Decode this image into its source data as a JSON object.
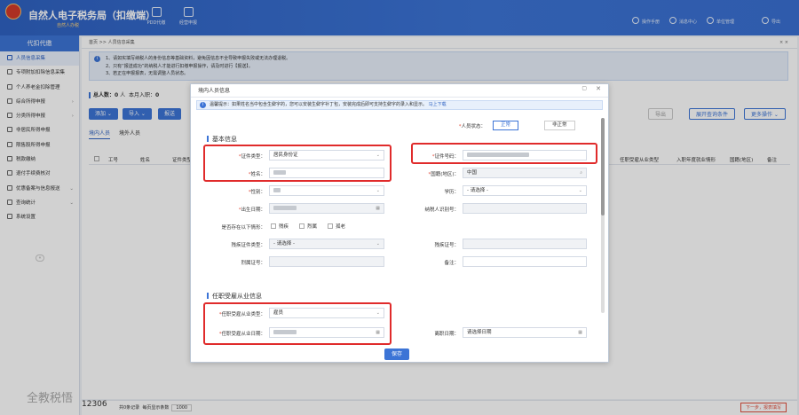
{
  "app": {
    "title": "自然人电子税务局（扣缴端）",
    "subtitle": "自然人办税",
    "toolbar": [
      "PDD代缴",
      "经营申报"
    ],
    "right_items": [
      "操作手册",
      "消息中心",
      "单位管理",
      "导出"
    ]
  },
  "sidebar": {
    "header": "代扣代缴",
    "items": [
      "人员信息采集",
      "专项附加扣除信息采集",
      "个人养老金扣除管理",
      "综合所得申报",
      "分类所得申报",
      "非居民所得申报",
      "限售股所得申报",
      "税款缴纳",
      "退付手续费核对",
      "优惠备案与信息报送",
      "查询统计",
      "系统设置"
    ]
  },
  "breadcrumb": {
    "home": "首页",
    "current": "人员信息采集"
  },
  "notice": [
    "1、请如实填写纳税人的身份信息等基础资料，避免因信息不全导致申报失败或无法办理退税。",
    "2、只有“报送成功”的纳税人才能进行扣缴申报操作，请及时进行【报送】。",
    "3、若正在申报报表，无需调整人员状态。"
  ],
  "stats": {
    "total_label": "总人数：",
    "total": "0",
    "unit": "人",
    "month_label": "本月入职：",
    "month": "0"
  },
  "buttons": {
    "add": "添加",
    "import": "导入",
    "report": "报送",
    "export": "导出",
    "show_query": "展开查询条件",
    "more": "更多操作"
  },
  "tabs": [
    "境内人员",
    "境外人员"
  ],
  "table_headers": [
    "工号",
    "姓名",
    "证件类型",
    "任职受雇从业类型",
    "入职年度就业情形",
    "国籍(地区)",
    "备注"
  ],
  "footer": {
    "number": "12306",
    "records": "共0条记录",
    "per_page_label": "每页显示条数",
    "per_page": "1000",
    "next": "下一步，报表填写"
  },
  "watermark": "全教税悟",
  "dialog": {
    "title": "境内人员信息",
    "tip": "温馨提示：如果姓名当中包含生僻字的，您可以安装生僻字补丁包，安装完成后即可支持生僻字的录入和显示。",
    "tip_link": "马上下载",
    "status_label": "人员状态：",
    "status_normal": "正常",
    "status_abnormal": "非正常",
    "section_basic": "基本信息",
    "id_type_label": "证件类型：",
    "id_type_value": "居民身份证",
    "id_no_label": "证件号码：",
    "name_label": "姓名：",
    "nationality_label": "国籍(地区)：",
    "nationality_value": "中国",
    "gender_label": "性别：",
    "education_label": "学历：",
    "education_value": "- 请选择 -",
    "birth_label": "出生日期：",
    "taxpayer_id_label": "纳税人识别号：",
    "disability_label": "是否存在以下情形：",
    "disability_options": [
      "残疾",
      "烈属",
      "孤老"
    ],
    "disability_id_type_label": "残疾证件类型：",
    "disability_id_type_value": "- 请选择 -",
    "disability_no_label": "残疾证号：",
    "martyr_no_label": "烈属证号：",
    "remark_label": "备注：",
    "section_job": "任职受雇从业信息",
    "job_type_label": "任职受雇从业类型：",
    "job_type_value": "雇员",
    "job_date_label": "任职受雇从业日期：",
    "leave_date_label": "离职日期：",
    "leave_date_value": "请选择日期",
    "save": "保存"
  },
  "colors": {
    "brand": "#3c74d6",
    "highlight": "#e02b2b"
  }
}
